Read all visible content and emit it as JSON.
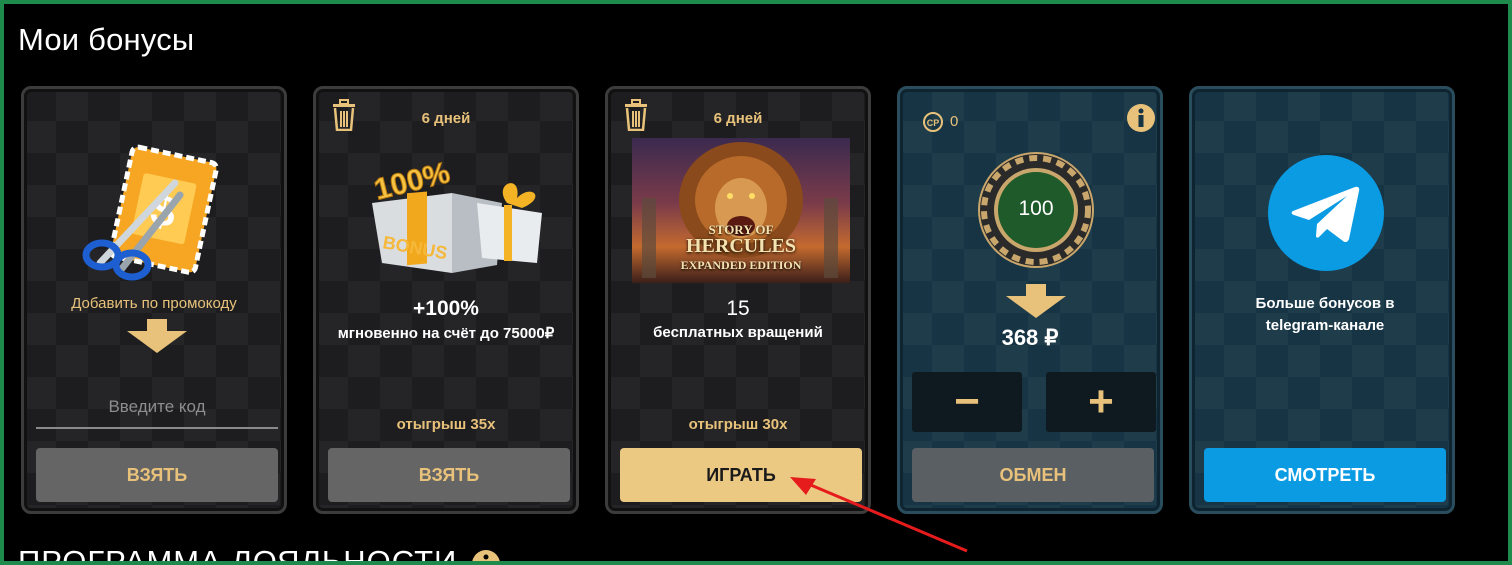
{
  "page": {
    "title": "Мои бонусы",
    "loyalty_title": "ПРОГРАММА ЛОЯЛЬНОСТИ"
  },
  "colors": {
    "border": "#1e8a4c",
    "gold": "#e8c27a",
    "gold_button": "#ecc983",
    "telegram_blue": "#0a9be3",
    "annotation_arrow": "#e61c1c"
  },
  "cards": {
    "promo": {
      "label": "Добавить по промокоду",
      "input_placeholder": "Введите код",
      "button": "ВЗЯТЬ",
      "image_icon": "coupon-scissors-icon"
    },
    "deposit": {
      "days": "6 дней",
      "value": "+100%",
      "description": "мгновенно на счёт до 75000₽",
      "wager": "отыгрыш 35x",
      "button": "ВЗЯТЬ",
      "image_text": "100%",
      "image_label": "BONUS"
    },
    "freespins": {
      "days": "6 дней",
      "game_title_line1": "STORY OF",
      "game_title_line2": "HERCULES",
      "game_title_line3": "EXPANDED EDITION",
      "value": "15",
      "description": "бесплатных вращений",
      "wager": "отыгрыш 30x",
      "button": "ИГРАТЬ"
    },
    "exchange": {
      "cp_label": "CP",
      "cp_value": "0",
      "chip_value": "100",
      "result": "368 ₽",
      "minus": "−",
      "plus": "+",
      "button": "ОБМЕН"
    },
    "telegram": {
      "text": "Больше бонусов в telegram-канале",
      "button": "СМОТРЕТЬ"
    }
  }
}
